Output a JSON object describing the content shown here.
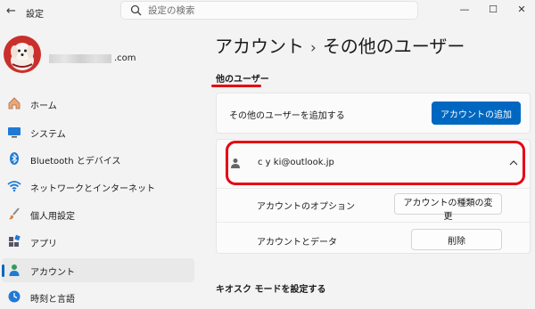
{
  "window": {
    "title": "設定",
    "back_icon": "back-arrow-icon",
    "minimize": "—",
    "maximize": "☐",
    "close": "✕"
  },
  "search": {
    "placeholder": "設定の検索",
    "value": ""
  },
  "profile": {
    "email_suffix": ".com",
    "avatar_bg": "#c9302c"
  },
  "nav": {
    "items": [
      {
        "label": "ホーム",
        "icon": "home-icon"
      },
      {
        "label": "システム",
        "icon": "monitor-icon"
      },
      {
        "label": "Bluetooth とデバイス",
        "icon": "bluetooth-icon"
      },
      {
        "label": "ネットワークとインターネット",
        "icon": "wifi-icon"
      },
      {
        "label": "個人用設定",
        "icon": "brush-icon"
      },
      {
        "label": "アプリ",
        "icon": "apps-icon"
      },
      {
        "label": "アカウント",
        "icon": "person-icon",
        "active": true
      },
      {
        "label": "時刻と言語",
        "icon": "clock-icon"
      }
    ]
  },
  "page": {
    "breadcrumb_parent": "アカウント",
    "separator": "›",
    "title": "その他のユーザー"
  },
  "section": {
    "title": "他のユーザー"
  },
  "add_user": {
    "label": "その他のユーザーを追加する",
    "button": "アカウントの追加"
  },
  "user": {
    "email": "c        y    ki@outlook.jp",
    "options_label": "アカウントのオプション",
    "options_button": "アカウントの種類の変更",
    "data_label": "アカウントとデータ",
    "delete_button": "削除"
  },
  "kiosk": {
    "title": "キオスク モードを設定する"
  },
  "colors": {
    "accent": "#0067c0",
    "highlight": "#e60012",
    "background": "#f3f3f3"
  }
}
